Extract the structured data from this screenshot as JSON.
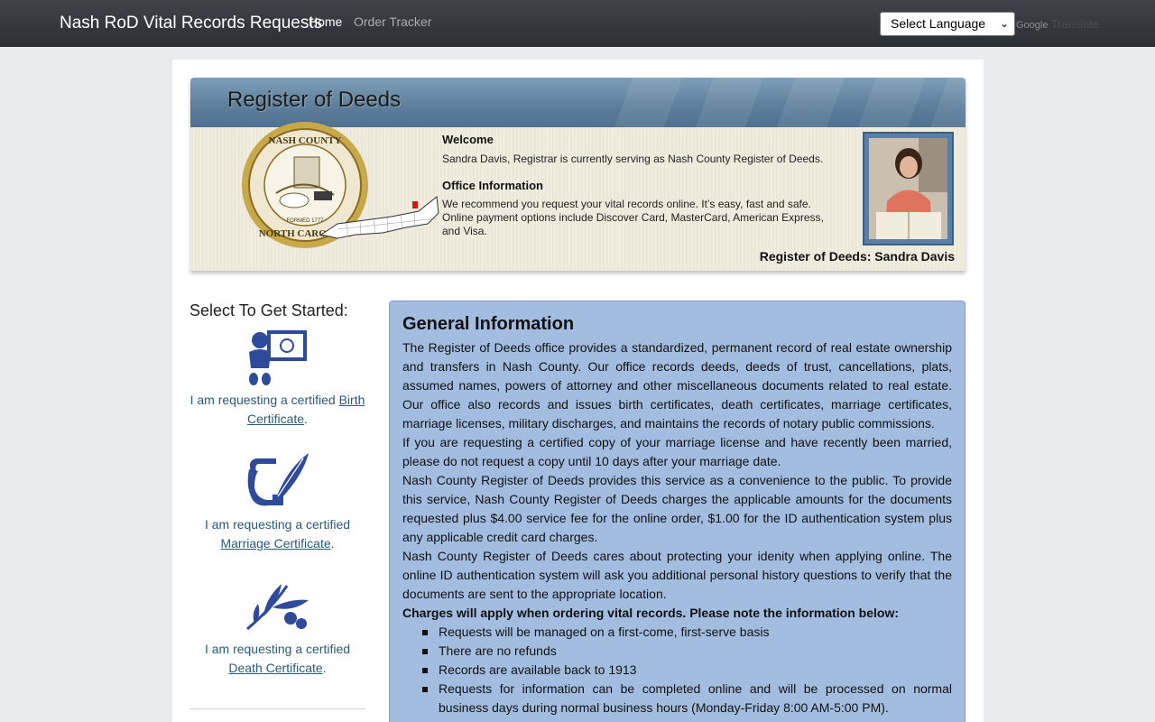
{
  "navbar": {
    "brand": "Nash RoD Vital Records Requests",
    "links": [
      "Home",
      "Order Tracker"
    ],
    "language_select": "Select Language",
    "translate_brand": "Google",
    "translate_label": "Translate"
  },
  "banner": {
    "title": "Register of Deeds",
    "welcome_heading": "Welcome",
    "welcome_text": "Sandra Davis, Registrar is currently serving as Nash County Register of Deeds.",
    "office_heading": "Office Information",
    "office_text": "We recommend you request your vital records online.  It’s easy, fast and safe.  Online payment options include Discover Card, MasterCard, American Express, and Visa.",
    "caption": "Register of Deeds: Sandra Davis",
    "seal_text": "NASH COUNTY NORTH CAROLINA FORMED 1777"
  },
  "sidebar": {
    "heading": "Select To Get Started:",
    "options": [
      {
        "prefix": "I am requesting a certified ",
        "link": "Birth Certificate",
        "suffix": ".",
        "icon": "baby-certificate-icon"
      },
      {
        "prefix": "I am requesting a certified ",
        "link": "Marriage Certificate",
        "suffix": ".",
        "icon": "scroll-quill-icon"
      },
      {
        "prefix": "I am requesting a certified ",
        "link": "Death Certificate",
        "suffix": ".",
        "icon": "olive-branch-icon"
      }
    ]
  },
  "general_info": {
    "heading": "General Information",
    "paragraphs": [
      "The Register of Deeds office provides a standardized, permanent record of real estate ownership and transfers in Nash County. Our office records deeds, deeds of trust, cancellations, plats, assumed names, powers of attorney and other miscellaneous documents related to real estate. Our office also records and issues birth certificates, death certificates, marriage certificates, marriage licenses, military discharges, and maintains the records of notary public commissions.",
      "If you are requesting a certified copy of your marriage license and have recently been married, please do not request a copy until 10 days after your marriage date.",
      "Nash County Register of Deeds provides this service as a convenience to the public. To provide this service, Nash County Register of Deeds charges the applicable amounts for the documents requested plus $4.00 service fee for the online order, $1.00 for the ID authentication system plus any applicable credit card charges.",
      "Nash County Register of Deeds cares about protecting your idenity when applying online. The online ID authentication system will ask you additional personal history questions to verify that the documents are sent to the appropriate location."
    ],
    "charges_note": "Charges will apply when ordering vital records.  Please note the information below:",
    "bullets": [
      "Requests will be managed on a first-come, first-serve basis",
      "There are no refunds",
      "Records are available back to 1913",
      "Requests for information can be completed online and will be processed on normal business days during normal business hours (Monday-Friday 8:00 AM-5:00 PM)."
    ]
  },
  "colors": {
    "navbar": "#343a40",
    "panel": "#a3bde0",
    "link": "#2a5b78",
    "icon": "#2e4a9a"
  }
}
